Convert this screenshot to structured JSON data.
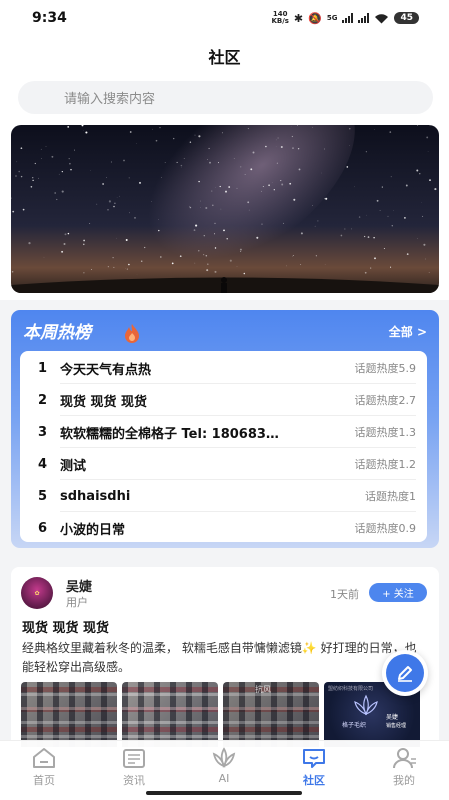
{
  "status_bar": {
    "time": "9:34",
    "net_speed_value": "140",
    "net_speed_unit": "KB/s",
    "icons": [
      "bluetooth-icon",
      "mute-icon",
      "5g-signal-icon",
      "signal-icon",
      "wifi-icon"
    ],
    "network_label": "5G",
    "battery": "45"
  },
  "header": {
    "title": "社区"
  },
  "search": {
    "placeholder": "请输入搜索内容"
  },
  "hot_list": {
    "title": "本周热榜",
    "more_label": "全部 >",
    "items": [
      {
        "rank": "1",
        "topic": "今天天气有点热",
        "heat": "话题热度5.9"
      },
      {
        "rank": "2",
        "topic": "现货 现货 现货",
        "heat": "话题热度2.7"
      },
      {
        "rank": "3",
        "topic": "软软糯糯的全棉格子 Tel: 180683…",
        "heat": "话题热度1.3"
      },
      {
        "rank": "4",
        "topic": "测试",
        "heat": "话题热度1.2"
      },
      {
        "rank": "5",
        "topic": "sdhaisdhi",
        "heat": "话题热度1"
      },
      {
        "rank": "6",
        "topic": "小波的日常",
        "heat": "话题热度0.9"
      }
    ]
  },
  "post": {
    "author": "吴婕",
    "role": "用户",
    "time": "1天前",
    "follow_label": "+ 关注",
    "title": "现货 现货 现货",
    "body": "经典格纹里藏着秋冬的温柔， 软糯毛感自带慵懒滤镜✨ 好打理的日常，也能轻松穿出高级感。",
    "thumb_watermark": "抗风",
    "thumb4_line0": "盟纺织科技有限公司",
    "thumb4_caption": "吴婕",
    "thumb4_sub": "销售经理",
    "thumb4_brand": "格子毛织"
  },
  "colors": {
    "accent": "#3f78e8",
    "hot_gradient_top": "#4f86ef",
    "heat_text": "#888888"
  },
  "tabs": [
    {
      "label": "首页",
      "icon": "home-icon",
      "active": false
    },
    {
      "label": "资讯",
      "icon": "news-icon",
      "active": false
    },
    {
      "label": "AI",
      "icon": "lotus-icon",
      "active": false
    },
    {
      "label": "社区",
      "icon": "chat-bubble-icon",
      "active": true
    },
    {
      "label": "我的",
      "icon": "user-icon",
      "active": false
    }
  ]
}
